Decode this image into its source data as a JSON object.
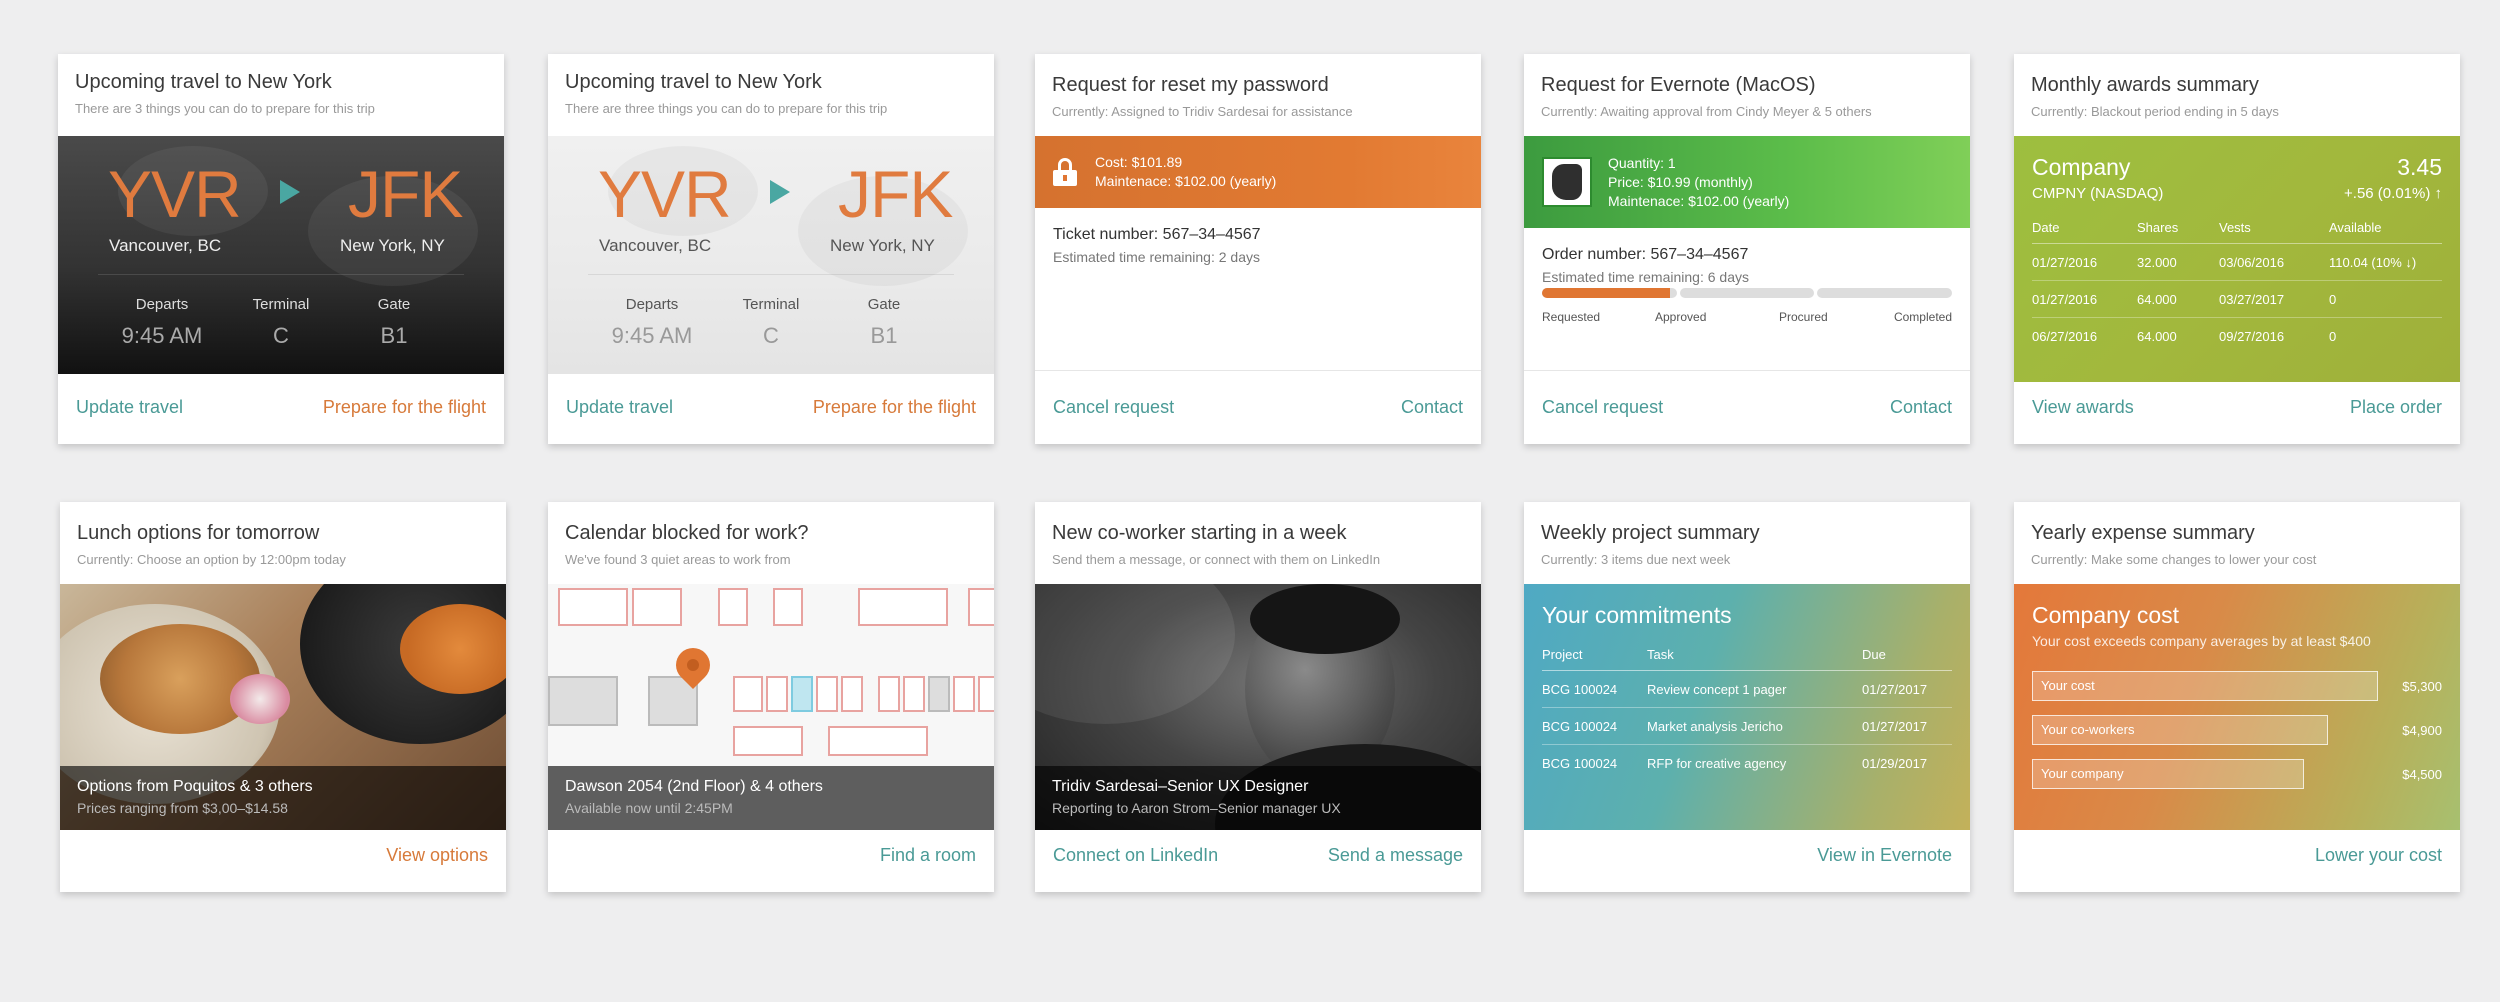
{
  "cards": {
    "travel1": {
      "title": "Upcoming travel to New York",
      "subtitle": "There are 3 things you can do to prepare for this trip",
      "from_code": "YVR",
      "to_code": "JFK",
      "from_city": "Vancouver, BC",
      "to_city": "New York, NY",
      "departs_label": "Departs",
      "terminal_label": "Terminal",
      "gate_label": "Gate",
      "departs": "9:45 AM",
      "terminal": "C",
      "gate": "B1",
      "action_left": "Update travel",
      "action_right": "Prepare for the flight"
    },
    "travel2": {
      "title": "Upcoming travel to New York",
      "subtitle": "There are three things you can do to prepare for this trip",
      "from_code": "YVR",
      "to_code": "JFK",
      "from_city": "Vancouver, BC",
      "to_city": "New York, NY",
      "departs_label": "Departs",
      "terminal_label": "Terminal",
      "gate_label": "Gate",
      "departs": "9:45 AM",
      "terminal": "C",
      "gate": "B1",
      "action_left": "Update travel",
      "action_right": "Prepare for the flight"
    },
    "password": {
      "title": "Request for reset my password",
      "subtitle": "Currently: Assigned to Tridiv Sardesai for assistance",
      "cost": "Cost: $101.89",
      "maintenance": "Maintenace: $102.00 (yearly)",
      "ticket": "Ticket number: 567–34–4567",
      "eta": "Estimated time remaining: 2 days",
      "action_left": "Cancel request",
      "action_right": "Contact"
    },
    "evernote": {
      "title": "Request for Evernote (MacOS)",
      "subtitle": "Currently: Awaiting approval from Cindy Meyer & 5 others",
      "quantity": "Quantity: 1",
      "price": "Price: $10.99 (monthly)",
      "maintenance": "Maintenace: $102.00 (yearly)",
      "order": "Order number: 567–34–4567",
      "eta": "Estimated time remaining: 6 days",
      "progress": 0.25,
      "steps": [
        "Requested",
        "Approved",
        "Procured",
        "Completed"
      ],
      "action_left": "Cancel request",
      "action_right": "Contact"
    },
    "awards": {
      "title": "Monthly awards summary",
      "subtitle": "Currently: Blackout period ending in 5 days",
      "company": "Company",
      "value": "3.45",
      "ticker": "CMPNY (NASDAQ)",
      "change": "+.56 (0.01%) ↑",
      "headers": [
        "Date",
        "Shares",
        "Vests",
        "Available"
      ],
      "rows": [
        [
          "01/27/2016",
          "32.000",
          "03/06/2016",
          "110.04 (10% ↓)"
        ],
        [
          "01/27/2016",
          "64.000",
          "03/27/2017",
          "0"
        ],
        [
          "06/27/2016",
          "64.000",
          "09/27/2016",
          "0"
        ]
      ],
      "action_left": "View awards",
      "action_right": "Place order"
    },
    "lunch": {
      "title": "Lunch options for tomorrow",
      "subtitle": "Currently: Choose an option by 12:00pm today",
      "caption": "Options from Poquitos & 3 others",
      "caption_sub": "Prices ranging from $3,00–$14.58",
      "action": "View options"
    },
    "calendar": {
      "title": "Calendar blocked for work?",
      "subtitle": "We've found 3 quiet areas to work from",
      "caption": "Dawson 2054 (2nd Floor) & 4 others",
      "caption_sub": "Available now until 2:45PM",
      "action": "Find a room"
    },
    "coworker": {
      "title": "New co-worker starting in a week",
      "subtitle": "Send them a message, or connect with them on LinkedIn",
      "caption": "Tridiv Sardesai–Senior UX Designer",
      "caption_sub": "Reporting to Aaron Strom–Senior manager UX",
      "action_left": "Connect on LinkedIn",
      "action_right": "Send a message"
    },
    "weekly": {
      "title": "Weekly project summary",
      "subtitle": "Currently: 3 items due next week",
      "heading": "Your commitments",
      "headers": [
        "Project",
        "Task",
        "Due"
      ],
      "rows": [
        [
          "BCG 100024",
          "Review concept 1 pager",
          "01/27/2017"
        ],
        [
          "BCG 100024",
          "Market analysis Jericho",
          "01/27/2017"
        ],
        [
          "BCG 100024",
          "RFP for creative agency",
          "01/29/2017"
        ]
      ],
      "action": "View in Evernote"
    },
    "expense": {
      "title": "Yearly expense summary",
      "subtitle": "Currently: Make some changes to lower your cost",
      "heading": "Company cost",
      "heading_sub": "Your cost exceeds company averages by at least $400",
      "bars": [
        {
          "label": "Your cost",
          "amount": "$5,300",
          "value": 5300
        },
        {
          "label": "Your co-workers",
          "amount": "$4,900",
          "value": 4900
        },
        {
          "label": "Your company",
          "amount": "$4,500",
          "value": 4500
        }
      ],
      "action": "Lower your cost"
    }
  },
  "colors": {
    "accent_orange": "#e07b3f",
    "accent_teal": "#4a9a96",
    "evernote_green": "#5cbd4a",
    "awards_green": "#9fb83d"
  }
}
